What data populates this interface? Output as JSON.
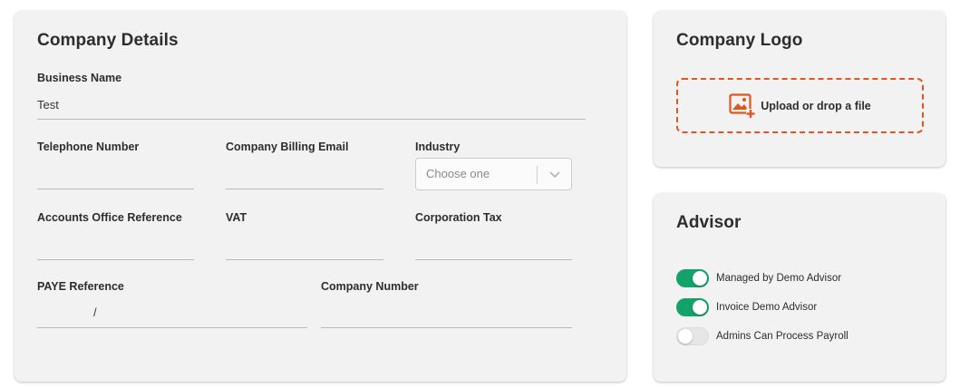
{
  "company_details": {
    "title": "Company Details",
    "business_name": {
      "label": "Business Name",
      "value": "Test"
    },
    "telephone": {
      "label": "Telephone Number",
      "value": ""
    },
    "billing_email": {
      "label": "Company Billing Email",
      "value": ""
    },
    "industry": {
      "label": "Industry",
      "placeholder": "Choose one",
      "icon": "chevron-down-icon"
    },
    "accounts_office_ref": {
      "label": "Accounts Office Reference",
      "value": ""
    },
    "vat": {
      "label": "VAT",
      "value": ""
    },
    "corporation_tax": {
      "label": "Corporation Tax",
      "value": ""
    },
    "paye_reference": {
      "label": "PAYE Reference",
      "separator": "/"
    },
    "company_number": {
      "label": "Company Number",
      "value": ""
    }
  },
  "company_logo": {
    "title": "Company Logo",
    "upload_label": "Upload or drop a file",
    "upload_icon": "image-add-icon",
    "accent_color": "#e0571d"
  },
  "advisor": {
    "title": "Advisor",
    "toggles": [
      {
        "label": "Managed by Demo Advisor",
        "on": true
      },
      {
        "label": "Invoice Demo Advisor",
        "on": true
      },
      {
        "label": "Admins Can Process Payroll",
        "on": false
      }
    ],
    "toggle_on_color": "#12a36a"
  }
}
